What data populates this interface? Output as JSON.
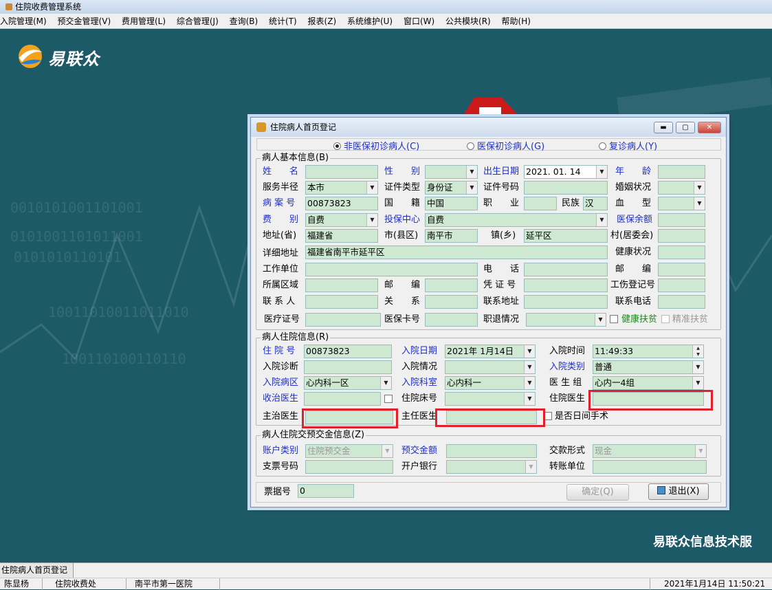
{
  "app": {
    "title": "住院收费管理系统"
  },
  "menu": [
    "入院管理(M)",
    "预交金管理(V)",
    "费用管理(L)",
    "综合管理(J)",
    "查询(B)",
    "统计(T)",
    "报表(Z)",
    "系统维护(U)",
    "窗口(W)",
    "公共模块(R)",
    "帮助(H)"
  ],
  "desktop": {
    "logo_text": "易联众",
    "company": "易联众信息技术服",
    "bg_digits": [
      "0010101001101001",
      "0101001101011001",
      "0101010110101",
      "10011010011011010",
      "100110100110110"
    ]
  },
  "dialog": {
    "title": "住院病人首页登记",
    "radios": {
      "r1": "非医保初诊病人(C)",
      "r2": "医保初诊病人(G)",
      "r3": "复诊病人(Y)"
    },
    "basic": {
      "title": "病人基本信息(B)",
      "labels": {
        "name": "姓　　名",
        "sex": "性　　别",
        "birth": "出生日期",
        "age": "年　　龄",
        "service": "服务半径",
        "idtype": "证件类型",
        "idno": "证件号码",
        "marriage": "婚姻状况",
        "record": "病 案 号",
        "nation": "国　　籍",
        "job": "职　　业",
        "ethnic": "民族",
        "blood": "血　　型",
        "fee": "费　　别",
        "center": "投保中心",
        "balance": "医保余额",
        "province": "地址(省)",
        "city": "市(县区)",
        "town": "镇(乡)",
        "village": "村(居委会)",
        "detail": "详细地址",
        "health": "健康状况",
        "work": "工作单位",
        "phone": "电　　话",
        "post": "邮　　编",
        "region": "所属区域",
        "post2": "邮　　编",
        "cert": "凭 证 号",
        "injury": "工伤登记号",
        "contact": "联 系 人",
        "relation": "关　　系",
        "contact_addr": "联系地址",
        "contact_phone": "联系电话",
        "medcert": "医疗证号",
        "medcard": "医保卡号",
        "retire": "职退情况",
        "poverty": "健康扶贫",
        "precise": "精准扶贫"
      },
      "values": {
        "birth": "2021. 01. 14",
        "service": "本市",
        "idtype": "身份证",
        "record": "00873823",
        "nation": "中国",
        "ethnic": "汉",
        "fee": "自费",
        "center": "自费",
        "province": "福建省",
        "city": "南平市",
        "town": "延平区",
        "detail": "福建省南平市延平区"
      }
    },
    "admission": {
      "title": "病人住院信息(R)",
      "labels": {
        "hosp_no": "住 院 号",
        "date": "入院日期",
        "time": "入院时间",
        "diag": "入院诊断",
        "status": "入院情况",
        "category": "入院类别",
        "ward": "入院病区",
        "dept": "入院科室",
        "group": "医 生 组",
        "admit_doc": "收治医生",
        "bed": "住院床号",
        "res_doc": "住院医生",
        "att_doc": "主治医生",
        "chief_doc": "主任医生",
        "day_surgery": "是否日间手术"
      },
      "values": {
        "hosp_no": "00873823",
        "date": "2021年 1月14日",
        "time": "11:49:33",
        "category": "普通",
        "ward": "心内科一区",
        "dept": "心内科一",
        "group": "心内一4组"
      }
    },
    "deposit": {
      "title": "病人住院交预交金信息(Z)",
      "labels": {
        "acct": "账户类别",
        "amount": "预交金额",
        "pay": "交款形式",
        "cheque": "支票号码",
        "bank": "开户银行",
        "transfer": "转账单位"
      },
      "values": {
        "acct": "住院预交金",
        "pay": "现金"
      }
    },
    "receipt": {
      "label": "票据号",
      "value": "0"
    },
    "buttons": {
      "ok": "确定(Q)",
      "exit": "退出(X)"
    }
  },
  "taskbar": {
    "item": "住院病人首页登记"
  },
  "status": {
    "user": "陈显杨",
    "dept": "住院收费处",
    "hospital": "南平市第一医院",
    "datetime": "2021年1月14日  11:50:21"
  },
  "colors": {
    "desktop": "#1d5a68",
    "field": "#cfe8d2",
    "label_blue": "#1e2ec8",
    "highlight": "#e0202a"
  }
}
